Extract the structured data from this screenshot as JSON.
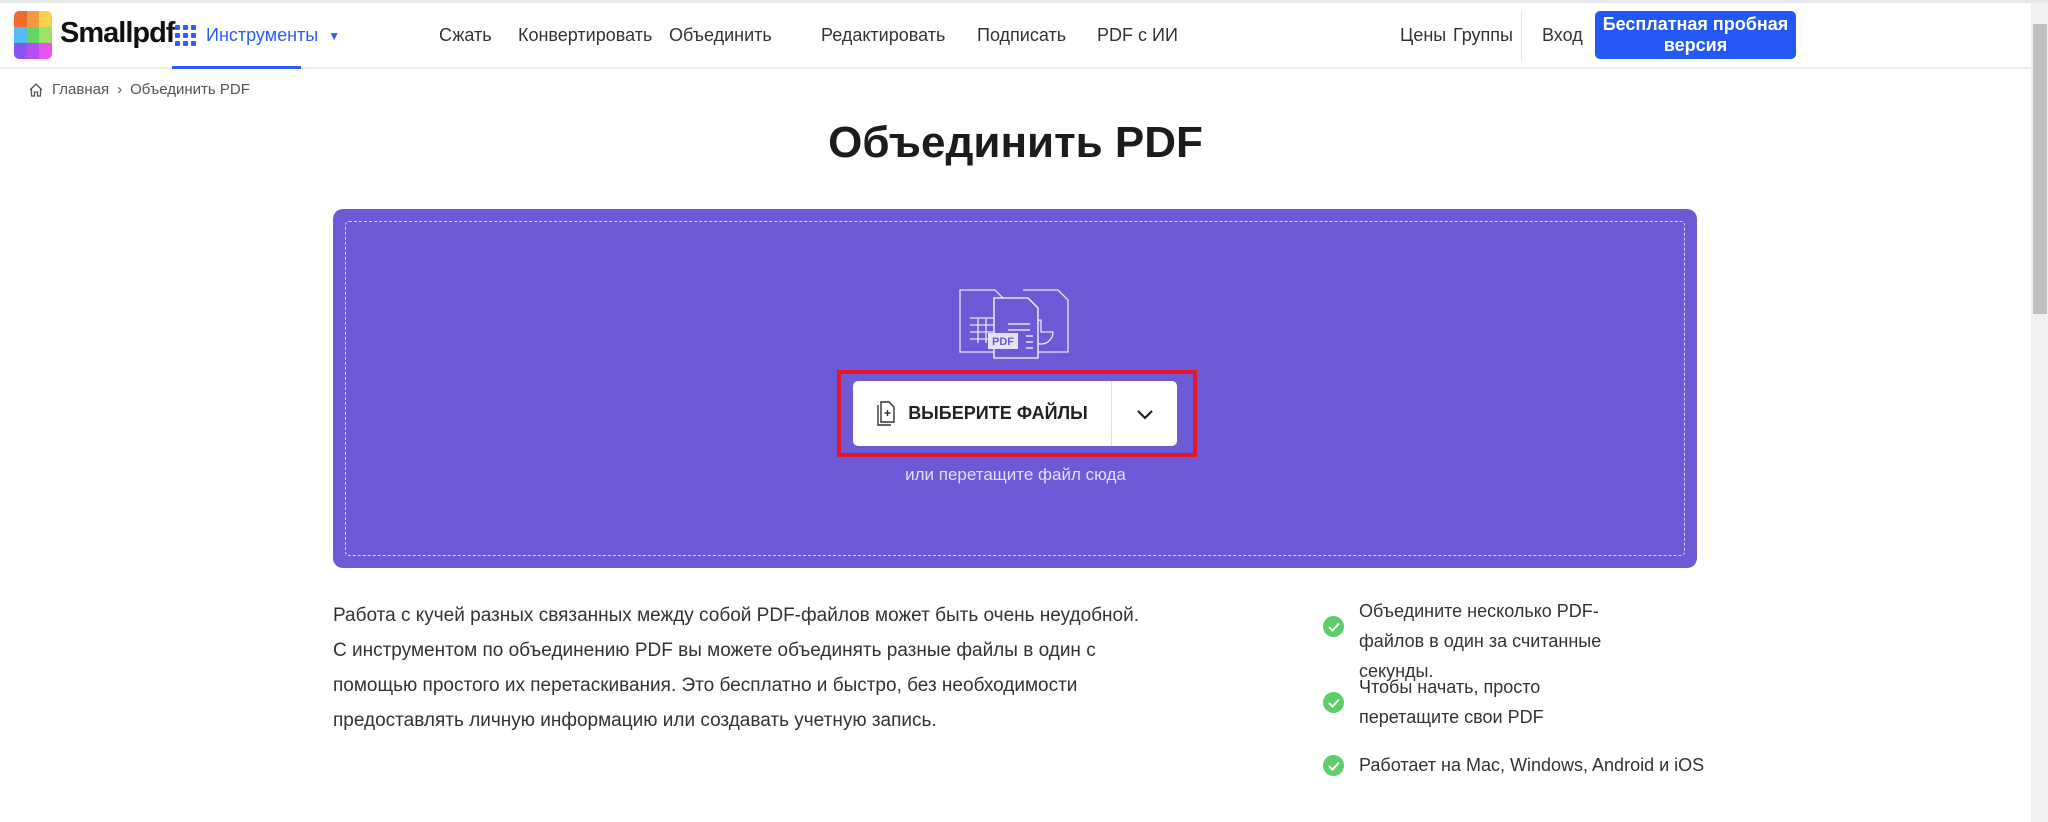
{
  "header": {
    "brand": "Smallpdf",
    "tools": "Инструменты",
    "nav": [
      "Сжать",
      "Конвертировать",
      "Объединить",
      "Редактировать",
      "Подписать",
      "PDF с ИИ"
    ],
    "pricing": "Цены",
    "teams": "Группы",
    "login": "Вход",
    "trial": "Бесплатная пробная версия"
  },
  "breadcrumb": {
    "home": "Главная",
    "current": "Объединить PDF"
  },
  "title": "Объединить PDF",
  "upload": {
    "choose": "ВЫБЕРИТЕ ФАЙЛЫ",
    "hint": "или перетащите файл сюда",
    "badge": "PDF"
  },
  "description": [
    "Работа с кучей разных связанных между собой PDF-файлов может быть очень неудобной.",
    "С инструментом по объединению PDF вы можете объединять разные файлы в один с",
    "помощью простого их перетаскивания. Это бесплатно и быстро, без необходимости",
    "предоставлять личную информацию или создавать учетную запись."
  ],
  "features": [
    "Объедините несколько PDF-файлов в один за считанные секунды.",
    "Чтобы начать, просто перетащите свои PDF",
    "Работает на Mac, Windows, Android и iOS"
  ],
  "colors": {
    "accent": "#2458f5",
    "dropzone": "#6c5ad7",
    "check": "#5ccf69",
    "highlight": "#e3162b"
  }
}
